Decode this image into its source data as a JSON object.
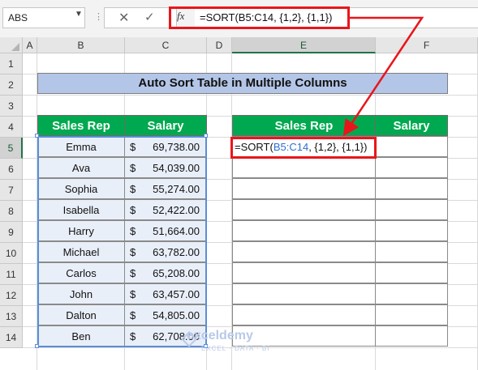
{
  "formula_bar": {
    "name_box": "ABS",
    "fx_label": "fx",
    "formula": "=SORT(B5:C14, {1,2}, {1,1})"
  },
  "columns": [
    "A",
    "B",
    "C",
    "D",
    "E",
    "F"
  ],
  "rows": [
    "1",
    "2",
    "3",
    "4",
    "5",
    "6",
    "7",
    "8",
    "9",
    "10",
    "11",
    "12",
    "13",
    "14"
  ],
  "title": "Auto Sort Table in Multiple Columns",
  "source_table": {
    "headers": [
      "Sales Rep",
      "Salary"
    ],
    "currency_symbol": "$",
    "rows": [
      {
        "name": "Emma",
        "salary": "69,738.00"
      },
      {
        "name": "Ava",
        "salary": "54,039.00"
      },
      {
        "name": "Sophia",
        "salary": "55,274.00"
      },
      {
        "name": "Isabella",
        "salary": "52,422.00"
      },
      {
        "name": "Harry",
        "salary": "51,664.00"
      },
      {
        "name": "Michael",
        "salary": "63,782.00"
      },
      {
        "name": "Carlos",
        "salary": "65,208.00"
      },
      {
        "name": "John",
        "salary": "63,457.00"
      },
      {
        "name": "Dalton",
        "salary": "54,805.00"
      },
      {
        "name": "Ben",
        "salary": "62,708.00"
      }
    ]
  },
  "output_table": {
    "headers": [
      "Sales Rep",
      "Salary"
    ],
    "edit_formula": {
      "prefix": "=SORT(",
      "ref": "B5:C14",
      "suffix": ", {1,2}, {1,1})"
    }
  },
  "watermark": {
    "name": "exceldemy",
    "tagline": "EXCEL · DATA · BI"
  },
  "colors": {
    "header_green": "#00a94f",
    "title_blue": "#b4c6e7",
    "highlight_red": "#e8161b"
  }
}
